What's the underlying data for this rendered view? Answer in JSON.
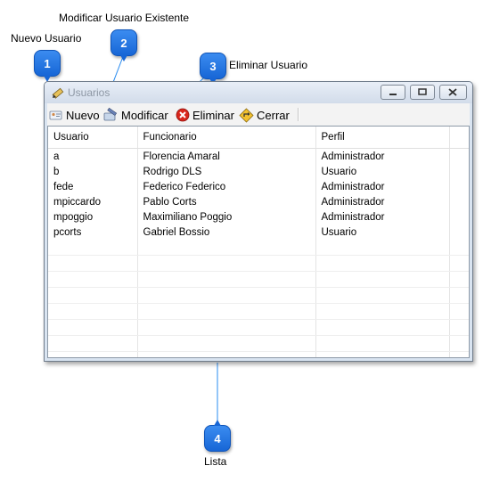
{
  "annotations": {
    "a1": {
      "number": "1",
      "label": "Nuevo Usuario"
    },
    "a2": {
      "number": "2",
      "label": "Modificar Usuario Existente"
    },
    "a3": {
      "number": "3",
      "label": "Eliminar Usuario"
    },
    "a4": {
      "number": "4",
      "label": "Lista"
    }
  },
  "window": {
    "title": "Usuarios",
    "icon": "pencil-edit-icon",
    "controls": [
      "minimize-icon",
      "maximize-icon",
      "close-icon"
    ]
  },
  "toolbar": {
    "nuevo": {
      "label": "Nuevo",
      "icon": "new-user-icon"
    },
    "modificar": {
      "label": "Modificar",
      "icon": "edit-icon"
    },
    "eliminar": {
      "label": "Eliminar",
      "icon": "delete-icon"
    },
    "cerrar": {
      "label": "Cerrar",
      "icon": "exit-icon"
    }
  },
  "grid": {
    "columns": [
      "Usuario",
      "Funcionario",
      "Perfil"
    ],
    "rows": [
      [
        "a",
        "Florencia Amaral",
        "Administrador"
      ],
      [
        "b",
        "Rodrigo DLS",
        "Usuario"
      ],
      [
        "fede",
        "Federico Federico",
        "Administrador"
      ],
      [
        "mpiccardo",
        "Pablo Corts",
        "Administrador"
      ],
      [
        "mpoggio",
        "Maximiliano Poggio",
        "Administrador"
      ],
      [
        "pcorts",
        "Gabriel Bossio",
        "Usuario"
      ]
    ]
  },
  "colors": {
    "badge": "#1e74e0",
    "leader_line": "#2a8cf0"
  }
}
